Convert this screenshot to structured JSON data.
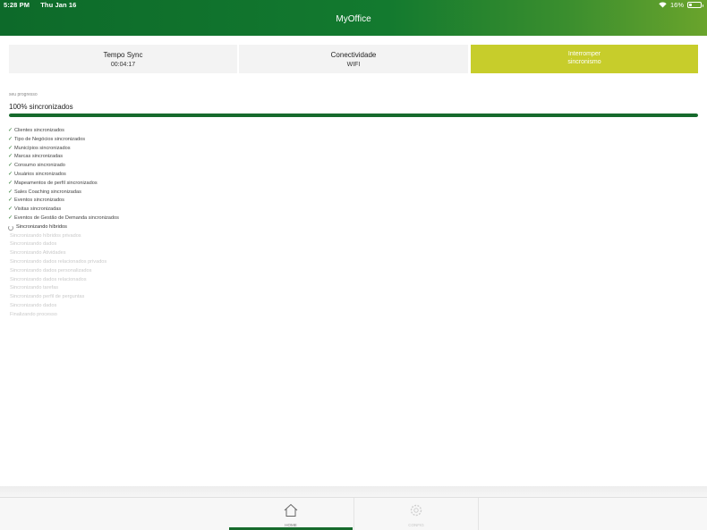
{
  "status_bar": {
    "time": "5:28 PM",
    "date": "Thu Jan 16",
    "battery": "16%"
  },
  "app": {
    "title": "MyOffice"
  },
  "cards": [
    {
      "title": "Tempo Sync",
      "value": "00:04:17"
    },
    {
      "title": "Conectividade",
      "value": "WIFI"
    },
    {
      "title": "Interromper",
      "value": "sincronismo"
    }
  ],
  "progress": {
    "label": "seu progresso",
    "value_text": "100% sincronizados",
    "fraction": 1.0
  },
  "sync_items": {
    "done": [
      "Clientes sincronizados",
      "Tipo de Negócios sincronizados",
      "Municípios sincronizados",
      "Marcas sincronizadas",
      "Consumo sincronizado",
      "Usuários sincronizados",
      "Mapeamentos de perfil sincronizados",
      "Sales Coaching sincronizadas",
      "Eventos sincronizados",
      "Visitas sincronizadas",
      "Eventos de Gestão de Demanda sincronizados"
    ],
    "active": "Sincronizando híbridos",
    "pending": [
      "Sincronizando híbridos privados",
      "Sincronizando dados",
      "Sincronizando Atividades",
      "Sincronizando dados relacionados privados",
      "Sincronizando dados personalizados",
      "Sincronizando dados relacionados",
      "Sincronizando tarefas",
      "Sincronizando perfil de perguntas",
      "Sincronizando dados",
      "Finalizando processo"
    ]
  },
  "tabbar": {
    "home_label": "HOME",
    "other_label": "CONFIG"
  },
  "colors": {
    "header_green": "#0d6a2a",
    "accent_yellow": "#c7cd2b",
    "progress_green": "#166a2c"
  }
}
